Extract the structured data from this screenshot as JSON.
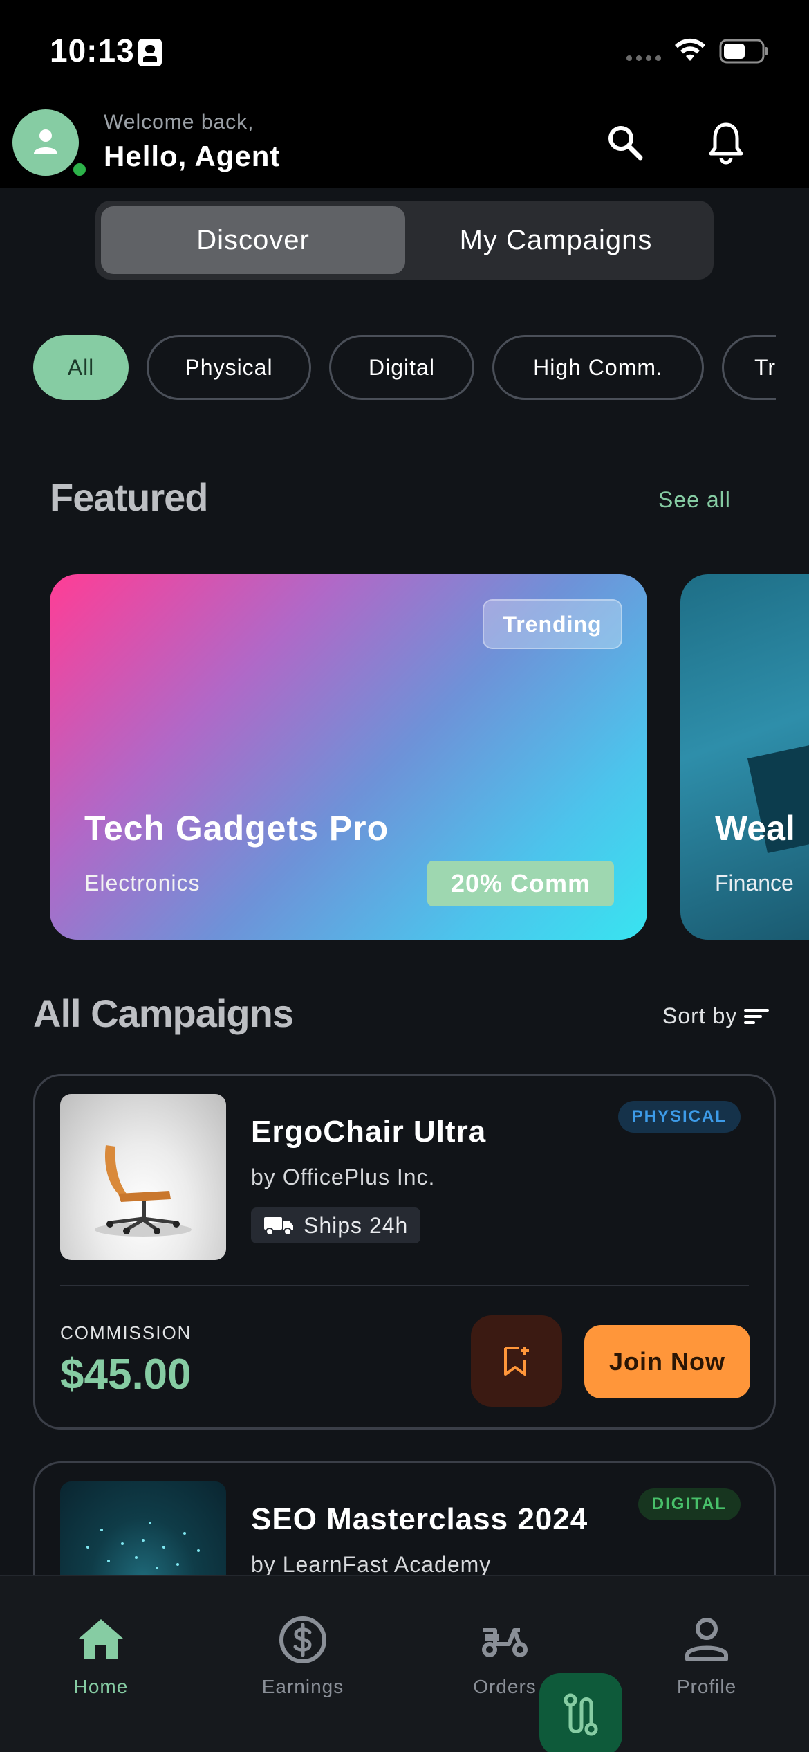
{
  "status_bar": {
    "time": "10:13"
  },
  "header": {
    "welcome_sub": "Welcome back,",
    "welcome_title": "Hello, Agent"
  },
  "tabs": [
    {
      "label": "Discover",
      "active": true
    },
    {
      "label": "My Campaigns",
      "active": false
    }
  ],
  "filters": [
    {
      "label": "All",
      "active": true
    },
    {
      "label": "Physical",
      "active": false
    },
    {
      "label": "Digital",
      "active": false
    },
    {
      "label": "High Comm.",
      "active": false
    },
    {
      "label": "Tr",
      "active": false
    }
  ],
  "featured": {
    "title": "Featured",
    "see_all": "See all",
    "cards": [
      {
        "badge": "Trending",
        "title": "Tech Gadgets Pro",
        "category": "Electronics",
        "commission": "20% Comm"
      },
      {
        "title": "Weal",
        "category": "Finance"
      }
    ]
  },
  "all_campaigns": {
    "title": "All Campaigns",
    "sort_label": "Sort by",
    "items": [
      {
        "title": "ErgoChair Ultra",
        "by": "by OfficePlus Inc.",
        "type": "PHYSICAL",
        "shipping": "Ships 24h",
        "commission_label": "COMMISSION",
        "commission_value": "$45.00",
        "join_label": "Join Now"
      },
      {
        "title": "SEO Masterclass 2024",
        "by": "by LearnFast Academy",
        "type": "DIGITAL"
      }
    ]
  },
  "bottom_nav": [
    {
      "label": "Home",
      "icon": "home-icon",
      "active": true
    },
    {
      "label": "Earnings",
      "icon": "dollar-circle-icon",
      "active": false
    },
    {
      "label": "Orders",
      "icon": "scooter-icon",
      "active": false
    },
    {
      "label": "Profile",
      "icon": "user-icon",
      "active": false
    }
  ],
  "colors": {
    "accent": "#86CCA3",
    "background": "#111418",
    "join": "#FF963A",
    "physical": "#3d9be8",
    "digital": "#48c06a"
  }
}
